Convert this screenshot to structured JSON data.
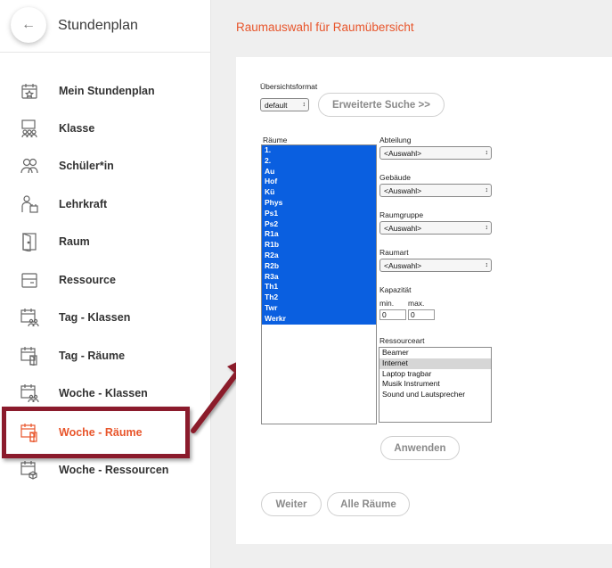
{
  "sidebar": {
    "back_icon": "arrow-left-icon",
    "title": "Stundenplan",
    "items": [
      {
        "label": "Mein Stundenplan",
        "icon": "calendar-star-icon"
      },
      {
        "label": "Klasse",
        "icon": "class-group-icon"
      },
      {
        "label": "Schüler*in",
        "icon": "students-icon"
      },
      {
        "label": "Lehrkraft",
        "icon": "teacher-icon"
      },
      {
        "label": "Raum",
        "icon": "door-icon"
      },
      {
        "label": "Ressource",
        "icon": "resource-box-icon"
      },
      {
        "label": "Tag - Klassen",
        "icon": "calendar-group-icon"
      },
      {
        "label": "Tag - Räume",
        "icon": "calendar-door-icon"
      },
      {
        "label": "Woche - Klassen",
        "icon": "calendar-group-icon"
      },
      {
        "label": "Woche - Räume",
        "icon": "calendar-door-icon",
        "active": true
      },
      {
        "label": "Woche - Ressourcen",
        "icon": "calendar-box-icon"
      }
    ]
  },
  "main": {
    "title": "Raumauswahl für Raumübersicht",
    "format_label": "Übersichtsformat",
    "format_value": "default",
    "advanced_search": "Erweiterte Suche >>",
    "rooms_label": "Räume",
    "rooms": [
      "1.",
      "2.",
      "Au",
      "Hof",
      "Kü",
      "Phys",
      "Ps1",
      "Ps2",
      "R1a",
      "R1b",
      "R2a",
      "R2b",
      "R3a",
      "Th1",
      "Th2",
      "Twr",
      "Werkr"
    ],
    "filters": [
      {
        "label": "Abteilung",
        "value": "<Auswahl>"
      },
      {
        "label": "Gebäude",
        "value": "<Auswahl>"
      },
      {
        "label": "Raumgruppe",
        "value": "<Auswahl>"
      },
      {
        "label": "Raumart",
        "value": "<Auswahl>"
      }
    ],
    "capacity_label": "Kapazität",
    "min_label": "min.",
    "max_label": "max.",
    "min_value": "0",
    "max_value": "0",
    "resource_label": "Ressourceart",
    "resources": [
      "Beamer",
      "Internet",
      "Laptop tragbar",
      "Musik Instrument",
      "Sound und Lautsprecher"
    ],
    "resource_selected": "Internet",
    "apply": "Anwenden",
    "next": "Weiter",
    "all_rooms": "Alle Räume"
  },
  "colors": {
    "accent": "#e8552b",
    "selection": "#0a5fe0",
    "highlight": "#8b1b2c"
  }
}
